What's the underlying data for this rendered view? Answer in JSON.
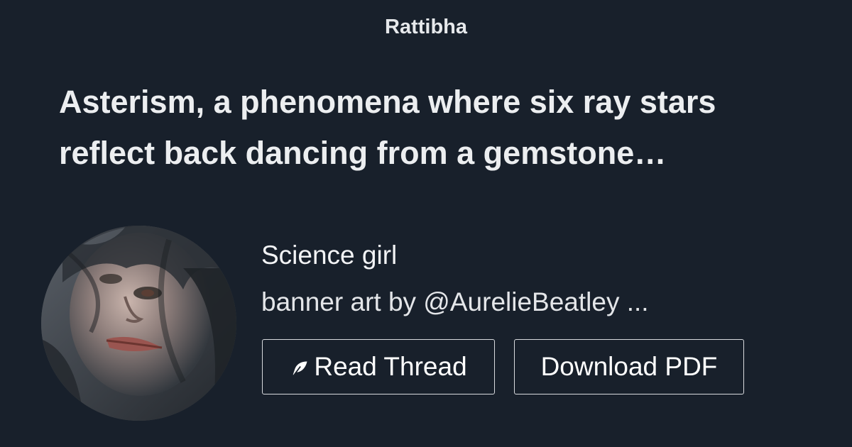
{
  "brand": "Rattibha",
  "thread": {
    "title": "Asterism, a phenomena where six ray stars\nreflect back dancing from a gemstone…"
  },
  "author": {
    "name": "Science girl",
    "bio": "banner art by @AurelieBeatley ..."
  },
  "actions": {
    "read_label": "Read Thread",
    "read_icon": "feather-icon",
    "pdf_label": "Download PDF"
  },
  "colors": {
    "background": "#18202b",
    "text": "#ffffff",
    "button_border": "#d8dade"
  }
}
